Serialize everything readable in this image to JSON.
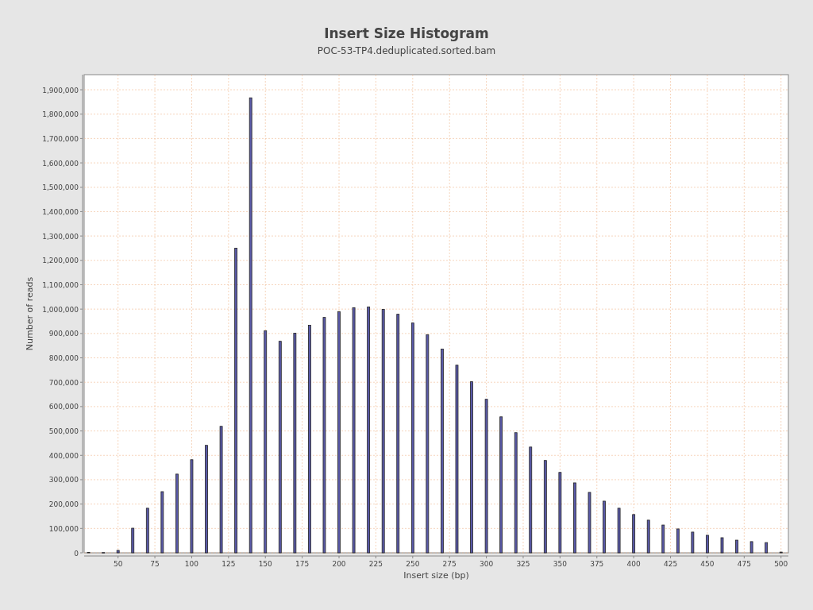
{
  "chart": {
    "title": "Insert Size Histogram",
    "subtitle": "POC-53-TP4.deduplicated.sorted.bam",
    "chart_data": {
      "type": "bar",
      "xlabel": "Insert size (bp)",
      "ylabel": "Number of reads",
      "x": [
        30,
        40,
        50,
        60,
        70,
        80,
        90,
        100,
        110,
        120,
        130,
        140,
        150,
        160,
        170,
        180,
        190,
        200,
        210,
        220,
        230,
        240,
        250,
        260,
        270,
        280,
        290,
        300,
        310,
        320,
        330,
        340,
        350,
        360,
        370,
        380,
        390,
        400,
        410,
        420,
        430,
        440,
        450,
        460,
        470,
        480,
        490,
        500
      ],
      "grid": true,
      "series": [
        {
          "color": "#5a5aa8",
          "values": [
            2000,
            1000,
            10000,
            101000,
            183000,
            251000,
            323000,
            382000,
            441000,
            519000,
            1250000,
            1867000,
            911000,
            868000,
            901000,
            934000,
            966000,
            989000,
            1006000,
            1009000,
            999000,
            979000,
            943000,
            895000,
            836000,
            770000,
            702000,
            630000,
            558000,
            493000,
            434000,
            379000,
            330000,
            287000,
            248000,
            212000,
            183000,
            157000,
            134000,
            114000,
            98000,
            85000,
            72000,
            62000,
            52000,
            46000,
            42000,
            3000
          ]
        }
      ],
      "xlim": [
        27,
        505
      ],
      "ylim": [
        0,
        1962000
      ],
      "xticks": [
        50,
        75,
        100,
        125,
        150,
        175,
        200,
        225,
        250,
        275,
        300,
        325,
        350,
        375,
        400,
        425,
        450,
        475,
        500
      ],
      "yticks": [
        {
          "value": 0,
          "label": "0"
        },
        {
          "value": 100000,
          "label": "100,000"
        },
        {
          "value": 200000,
          "label": "200,000"
        },
        {
          "value": 300000,
          "label": "300,000"
        },
        {
          "value": 400000,
          "label": "400,000"
        },
        {
          "value": 500000,
          "label": "500,000"
        },
        {
          "value": 600000,
          "label": "600,000"
        },
        {
          "value": 700000,
          "label": "700,000"
        },
        {
          "value": 800000,
          "label": "800,000"
        },
        {
          "value": 900000,
          "label": "900,000"
        },
        {
          "value": 1000000,
          "label": "1,000,000"
        },
        {
          "value": 1100000,
          "label": "1,100,000"
        },
        {
          "value": 1200000,
          "label": "1,200,000"
        },
        {
          "value": 1300000,
          "label": "1,300,000"
        },
        {
          "value": 1400000,
          "label": "1,400,000"
        },
        {
          "value": 1500000,
          "label": "1,500,000"
        },
        {
          "value": 1600000,
          "label": "1,600,000"
        },
        {
          "value": 1700000,
          "label": "1,700,000"
        },
        {
          "value": 1800000,
          "label": "1,800,000"
        },
        {
          "value": 1900000,
          "label": "1,900,000"
        }
      ]
    }
  }
}
